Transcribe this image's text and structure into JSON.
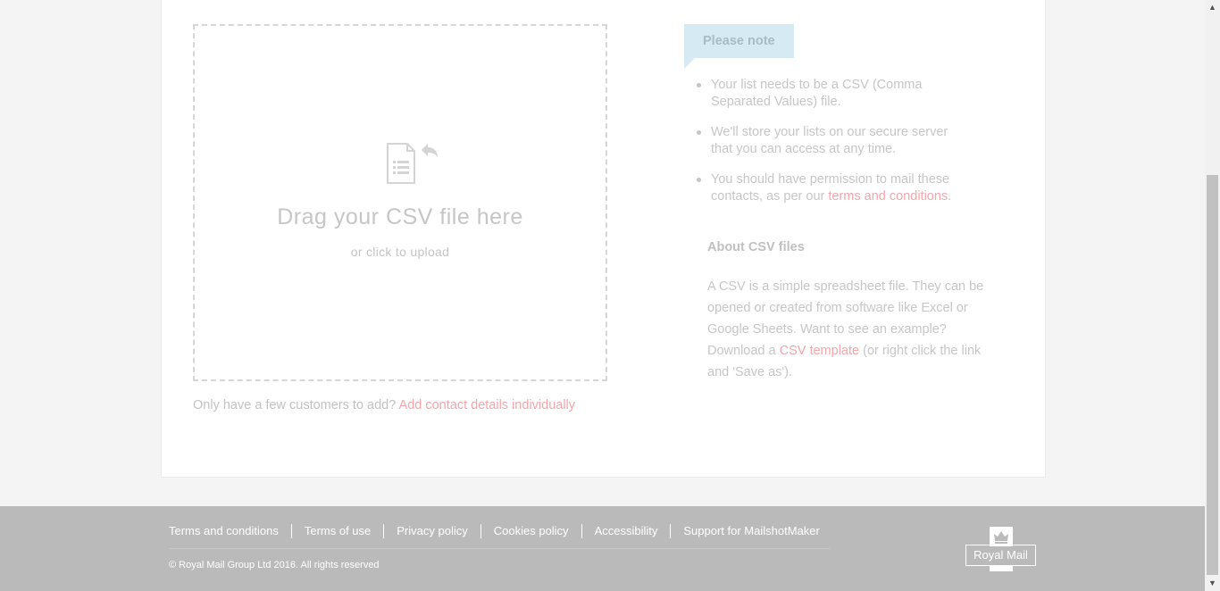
{
  "upload": {
    "title": "Drag your CSV file here",
    "subtitle": "or click to upload",
    "icon": "document-upload-icon"
  },
  "few_customers": {
    "text": "Only have a few customers to add?",
    "link": "Add contact details individually"
  },
  "note": {
    "tab_label": "Please note",
    "items": [
      {
        "text": "Your list needs to be a CSV (Comma Separated Values) file."
      },
      {
        "text": "We'll store your lists on our secure server that you can access at any time."
      },
      {
        "text_before": "You should have permission to mail these contacts, as per our",
        "link": "terms and conditions",
        "text_after": "."
      }
    ]
  },
  "about": {
    "heading": "About CSV files",
    "text_before": "A CSV is a simple spreadsheet file. They can be opened or created from software like Excel or Google Sheets. Want to see an example? Download a",
    "link": "CSV template",
    "text_after": "(or right click the link and 'Save as')."
  },
  "footer": {
    "links": [
      "Terms and conditions",
      "Terms of use",
      "Privacy policy",
      "Cookies policy",
      "Accessibility",
      "Support for MailshotMaker"
    ],
    "copyright": "© Royal Mail Group Ltd 2016. All rights reserved",
    "logo_text": "Royal Mail"
  },
  "colors": {
    "link": "#f2a6ab",
    "note_tab": "#d6eaf4",
    "footer_bg": "#bababa"
  }
}
